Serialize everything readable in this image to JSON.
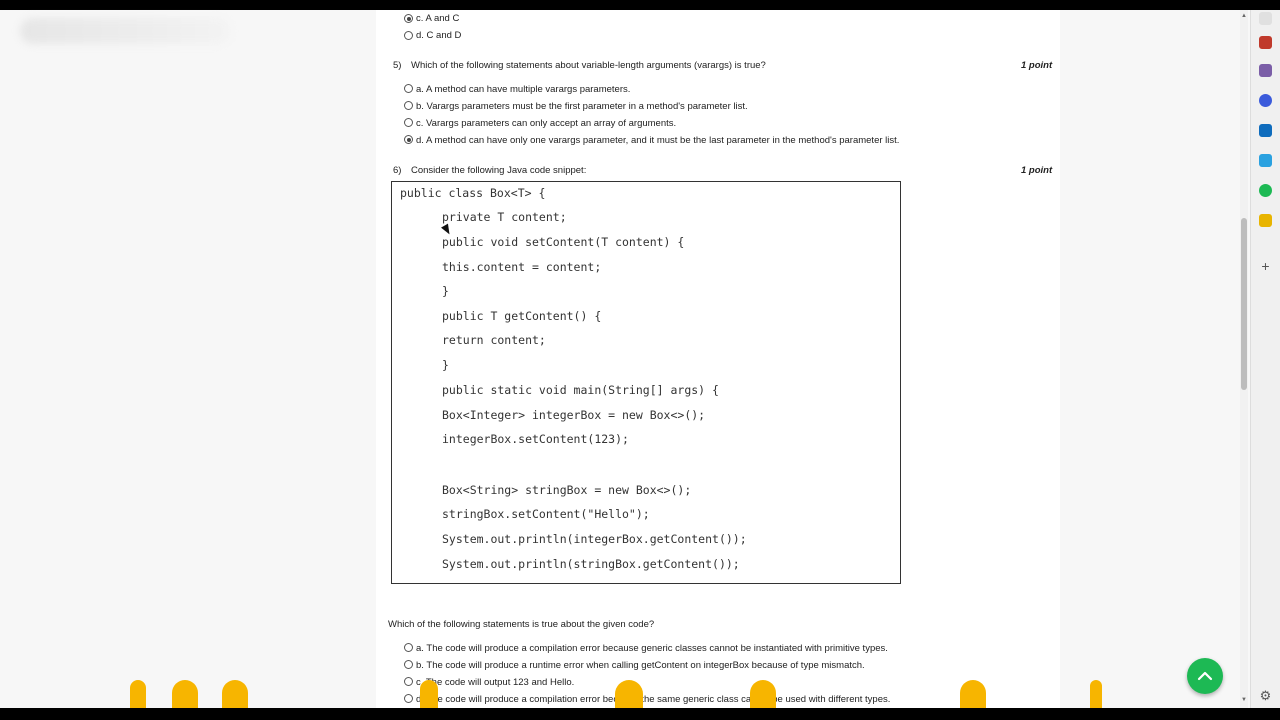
{
  "prev_question": {
    "options": [
      {
        "label": "c. A and C",
        "checked": true
      },
      {
        "label": "d. C and D",
        "checked": false
      }
    ]
  },
  "q5": {
    "number": "5)",
    "text": "Which of the following statements about variable-length arguments (varargs) is true?",
    "points": "1 point",
    "options": [
      {
        "label": "a. A method can have multiple varargs parameters.",
        "checked": false
      },
      {
        "label": "b. Varargs parameters must be the first parameter in a method's parameter list.",
        "checked": false
      },
      {
        "label": "c. Varargs parameters can only accept an array of arguments.",
        "checked": false
      },
      {
        "label": "d. A method can have only one varargs parameter, and it must be the last parameter in the method's parameter list.",
        "checked": true
      }
    ]
  },
  "q6": {
    "number": "6)",
    "text": "Consider the following Java code snippet:",
    "points": "1 point",
    "code": [
      "public class Box<T> {",
      "private T content;",
      "public void setContent(T content) {",
      "this.content = content;",
      "}",
      "public T getContent() {",
      "return content;",
      "}",
      "public static void main(String[] args) {",
      "Box<Integer> integerBox = new Box<>();",
      "integerBox.setContent(123);",
      "Box<String> stringBox = new Box<>();",
      "stringBox.setContent(\"Hello\");",
      "System.out.println(integerBox.getContent());",
      "System.out.println(stringBox.getContent());"
    ],
    "followup": "Which of the following statements is true about the given code?",
    "options": [
      {
        "label": "a. The code will produce a compilation error because generic classes cannot be instantiated with primitive types.",
        "checked": false
      },
      {
        "label": "b. The code will produce a runtime error when calling getContent on integerBox because of type mismatch.",
        "checked": false
      },
      {
        "label": "c. The code will output 123 and Hello.",
        "checked": false
      },
      {
        "label": "d. The code will produce a compilation error because the same generic class cannot be used with different types.",
        "checked": false
      }
    ]
  },
  "colors": {
    "fab": "#1db954",
    "ribbon": "#f7b500"
  },
  "icons": [
    "scroll-up-icon",
    "scroll-down-icon",
    "chevron-up-icon",
    "settings-icon",
    "add-icon"
  ]
}
